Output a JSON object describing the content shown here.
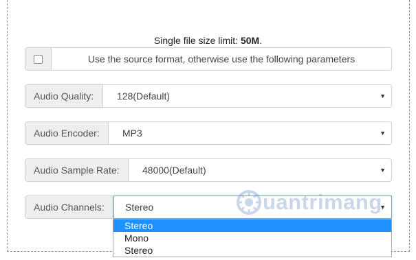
{
  "limit": {
    "prefix": "Single file size limit: ",
    "value": "50M",
    "suffix": "."
  },
  "source_format": {
    "checked": false,
    "label": "Use the source format, otherwise use the following parameters"
  },
  "audio_quality": {
    "label": "Audio Quality:",
    "value": "128(Default)"
  },
  "audio_encoder": {
    "label": "Audio Encoder:",
    "value": "MP3"
  },
  "sample_rate": {
    "label": "Audio Sample Rate:",
    "value": "48000(Default)"
  },
  "channels": {
    "label": "Audio Channels:",
    "value": "Stereo",
    "options": [
      "Stereo",
      "Mono",
      "Stereo"
    ],
    "highlighted_index": 0
  },
  "watermark": "uantrimang",
  "colors": {
    "highlight": "#1e90ff",
    "addon_bg": "#eeeeee",
    "frame_border": "#8a8fb8"
  },
  "icons": {
    "caret": "caret-down-icon",
    "checkbox": "checkbox-icon",
    "watermark_logo": "quantrimang-logo-icon"
  }
}
